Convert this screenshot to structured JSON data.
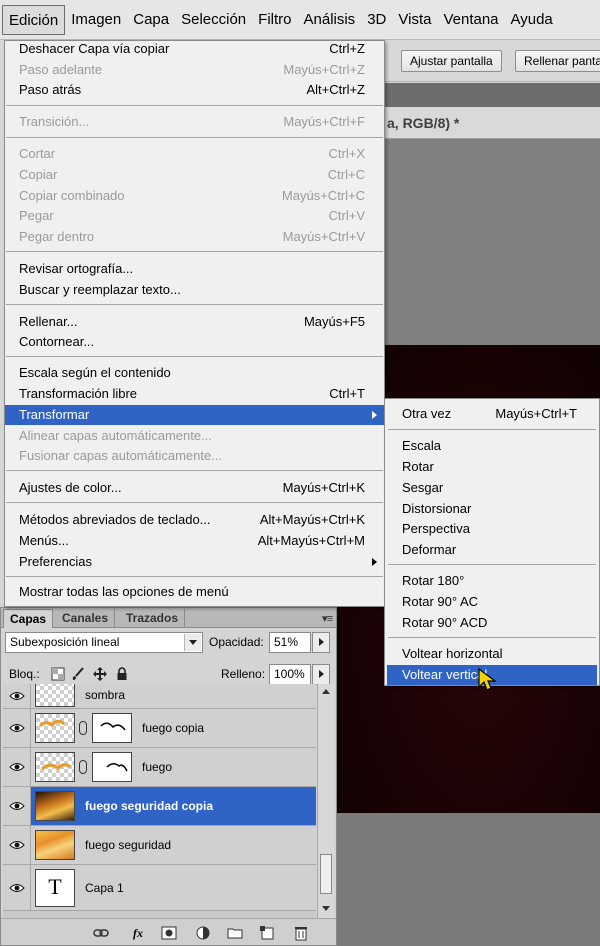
{
  "menubar": {
    "items": [
      "Edición",
      "Imagen",
      "Capa",
      "Selección",
      "Filtro",
      "Análisis",
      "3D",
      "Vista",
      "Ventana",
      "Ayuda"
    ]
  },
  "options_bar": {
    "fit_button": "Ajustar pantalla",
    "fill_button": "Rellenar panta"
  },
  "document": {
    "tab_title": "a, RGB/8) *"
  },
  "edit_menu": {
    "items": [
      {
        "label": "Deshacer Capa vía copiar",
        "shortcut": "Ctrl+Z"
      },
      {
        "label": "Paso adelante",
        "shortcut": "Mayús+Ctrl+Z"
      },
      {
        "label": "Paso atrás",
        "shortcut": "Alt+Ctrl+Z"
      },
      {
        "label": "Transición...",
        "shortcut": "Mayús+Ctrl+F"
      },
      {
        "label": "Cortar",
        "shortcut": "Ctrl+X"
      },
      {
        "label": "Copiar",
        "shortcut": "Ctrl+C"
      },
      {
        "label": "Copiar combinado",
        "shortcut": "Mayús+Ctrl+C"
      },
      {
        "label": "Pegar",
        "shortcut": "Ctrl+V"
      },
      {
        "label": "Pegar dentro",
        "shortcut": "Mayús+Ctrl+V"
      },
      {
        "label": "Revisar ortografía...",
        "shortcut": ""
      },
      {
        "label": "Buscar y reemplazar texto...",
        "shortcut": ""
      },
      {
        "label": "Rellenar...",
        "shortcut": "Mayús+F5"
      },
      {
        "label": "Contornear...",
        "shortcut": ""
      },
      {
        "label": "Escala según el contenido",
        "shortcut": ""
      },
      {
        "label": "Transformación libre",
        "shortcut": "Ctrl+T"
      },
      {
        "label": "Transformar",
        "shortcut": ""
      },
      {
        "label": "Alinear capas automáticamente...",
        "shortcut": ""
      },
      {
        "label": "Fusionar capas automáticamente...",
        "shortcut": ""
      },
      {
        "label": "Ajustes de color...",
        "shortcut": "Mayús+Ctrl+K"
      },
      {
        "label": "Métodos abreviados de teclado...",
        "shortcut": "Alt+Mayús+Ctrl+K"
      },
      {
        "label": "Menús...",
        "shortcut": "Alt+Mayús+Ctrl+M"
      },
      {
        "label": "Preferencias",
        "shortcut": ""
      },
      {
        "label": "Mostrar todas las opciones de menú",
        "shortcut": ""
      }
    ]
  },
  "transform_submenu": {
    "items": [
      {
        "label": "Otra vez",
        "shortcut": "Mayús+Ctrl+T"
      },
      {
        "label": "Escala",
        "shortcut": ""
      },
      {
        "label": "Rotar",
        "shortcut": ""
      },
      {
        "label": "Sesgar",
        "shortcut": ""
      },
      {
        "label": "Distorsionar",
        "shortcut": ""
      },
      {
        "label": "Perspectiva",
        "shortcut": ""
      },
      {
        "label": "Deformar",
        "shortcut": ""
      },
      {
        "label": "Rotar 180°",
        "shortcut": ""
      },
      {
        "label": "Rotar 90° AC",
        "shortcut": ""
      },
      {
        "label": "Rotar 90° ACD",
        "shortcut": ""
      },
      {
        "label": "Voltear horizontal",
        "shortcut": ""
      },
      {
        "label": "Voltear vertical",
        "shortcut": ""
      }
    ]
  },
  "layers_panel": {
    "tabs": [
      "Capas",
      "Canales",
      "Trazados"
    ],
    "panel_menu_glyph": "▾≡",
    "blend_mode": "Subexposición lineal",
    "opacity_label": "Opacidad:",
    "opacity_value": "51%",
    "lock_label": "Bloq.:",
    "fill_label": "Relleno:",
    "fill_value": "100%",
    "text_thumb_glyph": "T",
    "footer_fx": "fx",
    "layers": [
      {
        "name": "sombra"
      },
      {
        "name": "fuego copia"
      },
      {
        "name": "fuego"
      },
      {
        "name": "fuego seguridad copia"
      },
      {
        "name": "fuego seguridad"
      },
      {
        "name": "Capa 1"
      }
    ]
  },
  "colors": {
    "highlight": "#2f64c6",
    "disabled_text": "#9a9a9a"
  }
}
